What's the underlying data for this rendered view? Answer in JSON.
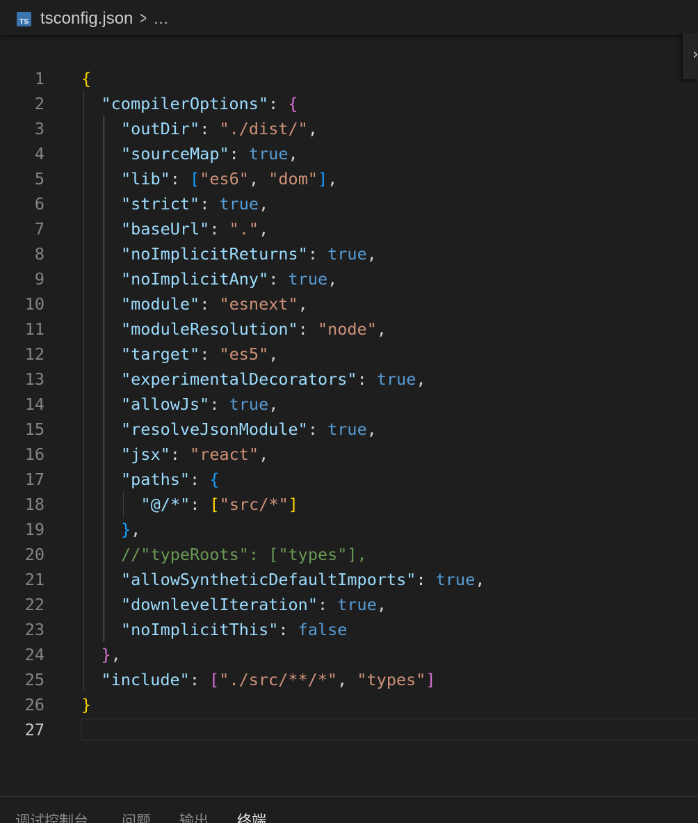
{
  "breadcrumb": {
    "file_icon": "TS",
    "file_name": "tsconfig.json",
    "separator": ">",
    "more": "..."
  },
  "find_widget": {
    "toggle_glyph": "›"
  },
  "editor": {
    "language": "json",
    "active_line": 27,
    "colors": {
      "background": "#1e1e1e",
      "key": "#9cdcfe",
      "string": "#ce9178",
      "keyword": "#569cd6",
      "comment": "#6a9955",
      "bracket_level_1": "#ffd700",
      "bracket_level_2": "#da70d6",
      "bracket_level_3": "#179fff"
    },
    "lines": [
      {
        "n": "1",
        "indent": 0,
        "tokens": [
          [
            "b1",
            "{"
          ]
        ]
      },
      {
        "n": "2",
        "indent": 1,
        "tokens": [
          [
            "key",
            "\"compilerOptions\""
          ],
          [
            "p",
            ": "
          ],
          [
            "b2",
            "{"
          ]
        ]
      },
      {
        "n": "3",
        "indent": 2,
        "tokens": [
          [
            "key",
            "\"outDir\""
          ],
          [
            "p",
            ": "
          ],
          [
            "str",
            "\"./dist/\""
          ],
          [
            "p",
            ","
          ]
        ]
      },
      {
        "n": "4",
        "indent": 2,
        "tokens": [
          [
            "key",
            "\"sourceMap\""
          ],
          [
            "p",
            ": "
          ],
          [
            "kw",
            "true"
          ],
          [
            "p",
            ","
          ]
        ]
      },
      {
        "n": "5",
        "indent": 2,
        "tokens": [
          [
            "key",
            "\"lib\""
          ],
          [
            "p",
            ": "
          ],
          [
            "b3",
            "["
          ],
          [
            "str",
            "\"es6\""
          ],
          [
            "p",
            ", "
          ],
          [
            "str",
            "\"dom\""
          ],
          [
            "b3",
            "]"
          ],
          [
            "p",
            ","
          ]
        ]
      },
      {
        "n": "6",
        "indent": 2,
        "tokens": [
          [
            "key",
            "\"strict\""
          ],
          [
            "p",
            ": "
          ],
          [
            "kw",
            "true"
          ],
          [
            "p",
            ","
          ]
        ]
      },
      {
        "n": "7",
        "indent": 2,
        "tokens": [
          [
            "key",
            "\"baseUrl\""
          ],
          [
            "p",
            ": "
          ],
          [
            "str",
            "\".\""
          ],
          [
            "p",
            ","
          ]
        ]
      },
      {
        "n": "8",
        "indent": 2,
        "tokens": [
          [
            "key",
            "\"noImplicitReturns\""
          ],
          [
            "p",
            ": "
          ],
          [
            "kw",
            "true"
          ],
          [
            "p",
            ","
          ]
        ]
      },
      {
        "n": "9",
        "indent": 2,
        "tokens": [
          [
            "key",
            "\"noImplicitAny\""
          ],
          [
            "p",
            ": "
          ],
          [
            "kw",
            "true"
          ],
          [
            "p",
            ","
          ]
        ]
      },
      {
        "n": "10",
        "indent": 2,
        "tokens": [
          [
            "key",
            "\"module\""
          ],
          [
            "p",
            ": "
          ],
          [
            "str",
            "\"esnext\""
          ],
          [
            "p",
            ","
          ]
        ]
      },
      {
        "n": "11",
        "indent": 2,
        "tokens": [
          [
            "key",
            "\"moduleResolution\""
          ],
          [
            "p",
            ": "
          ],
          [
            "str",
            "\"node\""
          ],
          [
            "p",
            ","
          ]
        ]
      },
      {
        "n": "12",
        "indent": 2,
        "tokens": [
          [
            "key",
            "\"target\""
          ],
          [
            "p",
            ": "
          ],
          [
            "str",
            "\"es5\""
          ],
          [
            "p",
            ","
          ]
        ]
      },
      {
        "n": "13",
        "indent": 2,
        "tokens": [
          [
            "key",
            "\"experimentalDecorators\""
          ],
          [
            "p",
            ": "
          ],
          [
            "kw",
            "true"
          ],
          [
            "p",
            ","
          ]
        ]
      },
      {
        "n": "14",
        "indent": 2,
        "tokens": [
          [
            "key",
            "\"allowJs\""
          ],
          [
            "p",
            ": "
          ],
          [
            "kw",
            "true"
          ],
          [
            "p",
            ","
          ]
        ]
      },
      {
        "n": "15",
        "indent": 2,
        "tokens": [
          [
            "key",
            "\"resolveJsonModule\""
          ],
          [
            "p",
            ": "
          ],
          [
            "kw",
            "true"
          ],
          [
            "p",
            ","
          ]
        ]
      },
      {
        "n": "16",
        "indent": 2,
        "tokens": [
          [
            "key",
            "\"jsx\""
          ],
          [
            "p",
            ": "
          ],
          [
            "str",
            "\"react\""
          ],
          [
            "p",
            ","
          ]
        ]
      },
      {
        "n": "17",
        "indent": 2,
        "tokens": [
          [
            "key",
            "\"paths\""
          ],
          [
            "p",
            ": "
          ],
          [
            "b3",
            "{"
          ]
        ]
      },
      {
        "n": "18",
        "indent": 3,
        "tokens": [
          [
            "key",
            "\"@/*\""
          ],
          [
            "p",
            ": "
          ],
          [
            "b1",
            "["
          ],
          [
            "str",
            "\"src/*\""
          ],
          [
            "b1",
            "]"
          ]
        ]
      },
      {
        "n": "19",
        "indent": 2,
        "tokens": [
          [
            "b3",
            "}"
          ],
          [
            "p",
            ","
          ]
        ]
      },
      {
        "n": "20",
        "indent": 2,
        "tokens": [
          [
            "cmt",
            "//\"typeRoots\": [\"types\"],"
          ]
        ]
      },
      {
        "n": "21",
        "indent": 2,
        "tokens": [
          [
            "key",
            "\"allowSyntheticDefaultImports\""
          ],
          [
            "p",
            ": "
          ],
          [
            "kw",
            "true"
          ],
          [
            "p",
            ","
          ]
        ]
      },
      {
        "n": "22",
        "indent": 2,
        "tokens": [
          [
            "key",
            "\"downlevelIteration\""
          ],
          [
            "p",
            ": "
          ],
          [
            "kw",
            "true"
          ],
          [
            "p",
            ","
          ]
        ]
      },
      {
        "n": "23",
        "indent": 2,
        "tokens": [
          [
            "key",
            "\"noImplicitThis\""
          ],
          [
            "p",
            ": "
          ],
          [
            "kw",
            "false"
          ]
        ]
      },
      {
        "n": "24",
        "indent": 1,
        "tokens": [
          [
            "b2",
            "}"
          ],
          [
            "p",
            ","
          ]
        ]
      },
      {
        "n": "25",
        "indent": 1,
        "tokens": [
          [
            "key",
            "\"include\""
          ],
          [
            "p",
            ": "
          ],
          [
            "b2",
            "["
          ],
          [
            "str",
            "\"./src/**/*\""
          ],
          [
            "p",
            ", "
          ],
          [
            "str",
            "\"types\""
          ],
          [
            "b2",
            "]"
          ]
        ]
      },
      {
        "n": "26",
        "indent": 0,
        "tokens": [
          [
            "b1",
            "}"
          ]
        ]
      },
      {
        "n": "27",
        "indent": 0,
        "tokens": []
      }
    ]
  },
  "panel": {
    "tabs": [
      {
        "id": "debug-console",
        "label": "调试控制台",
        "active": false
      },
      {
        "id": "problems",
        "label": "问题",
        "active": false
      },
      {
        "id": "output",
        "label": "输出",
        "active": false
      },
      {
        "id": "terminal",
        "label": "终端",
        "active": true
      }
    ]
  }
}
